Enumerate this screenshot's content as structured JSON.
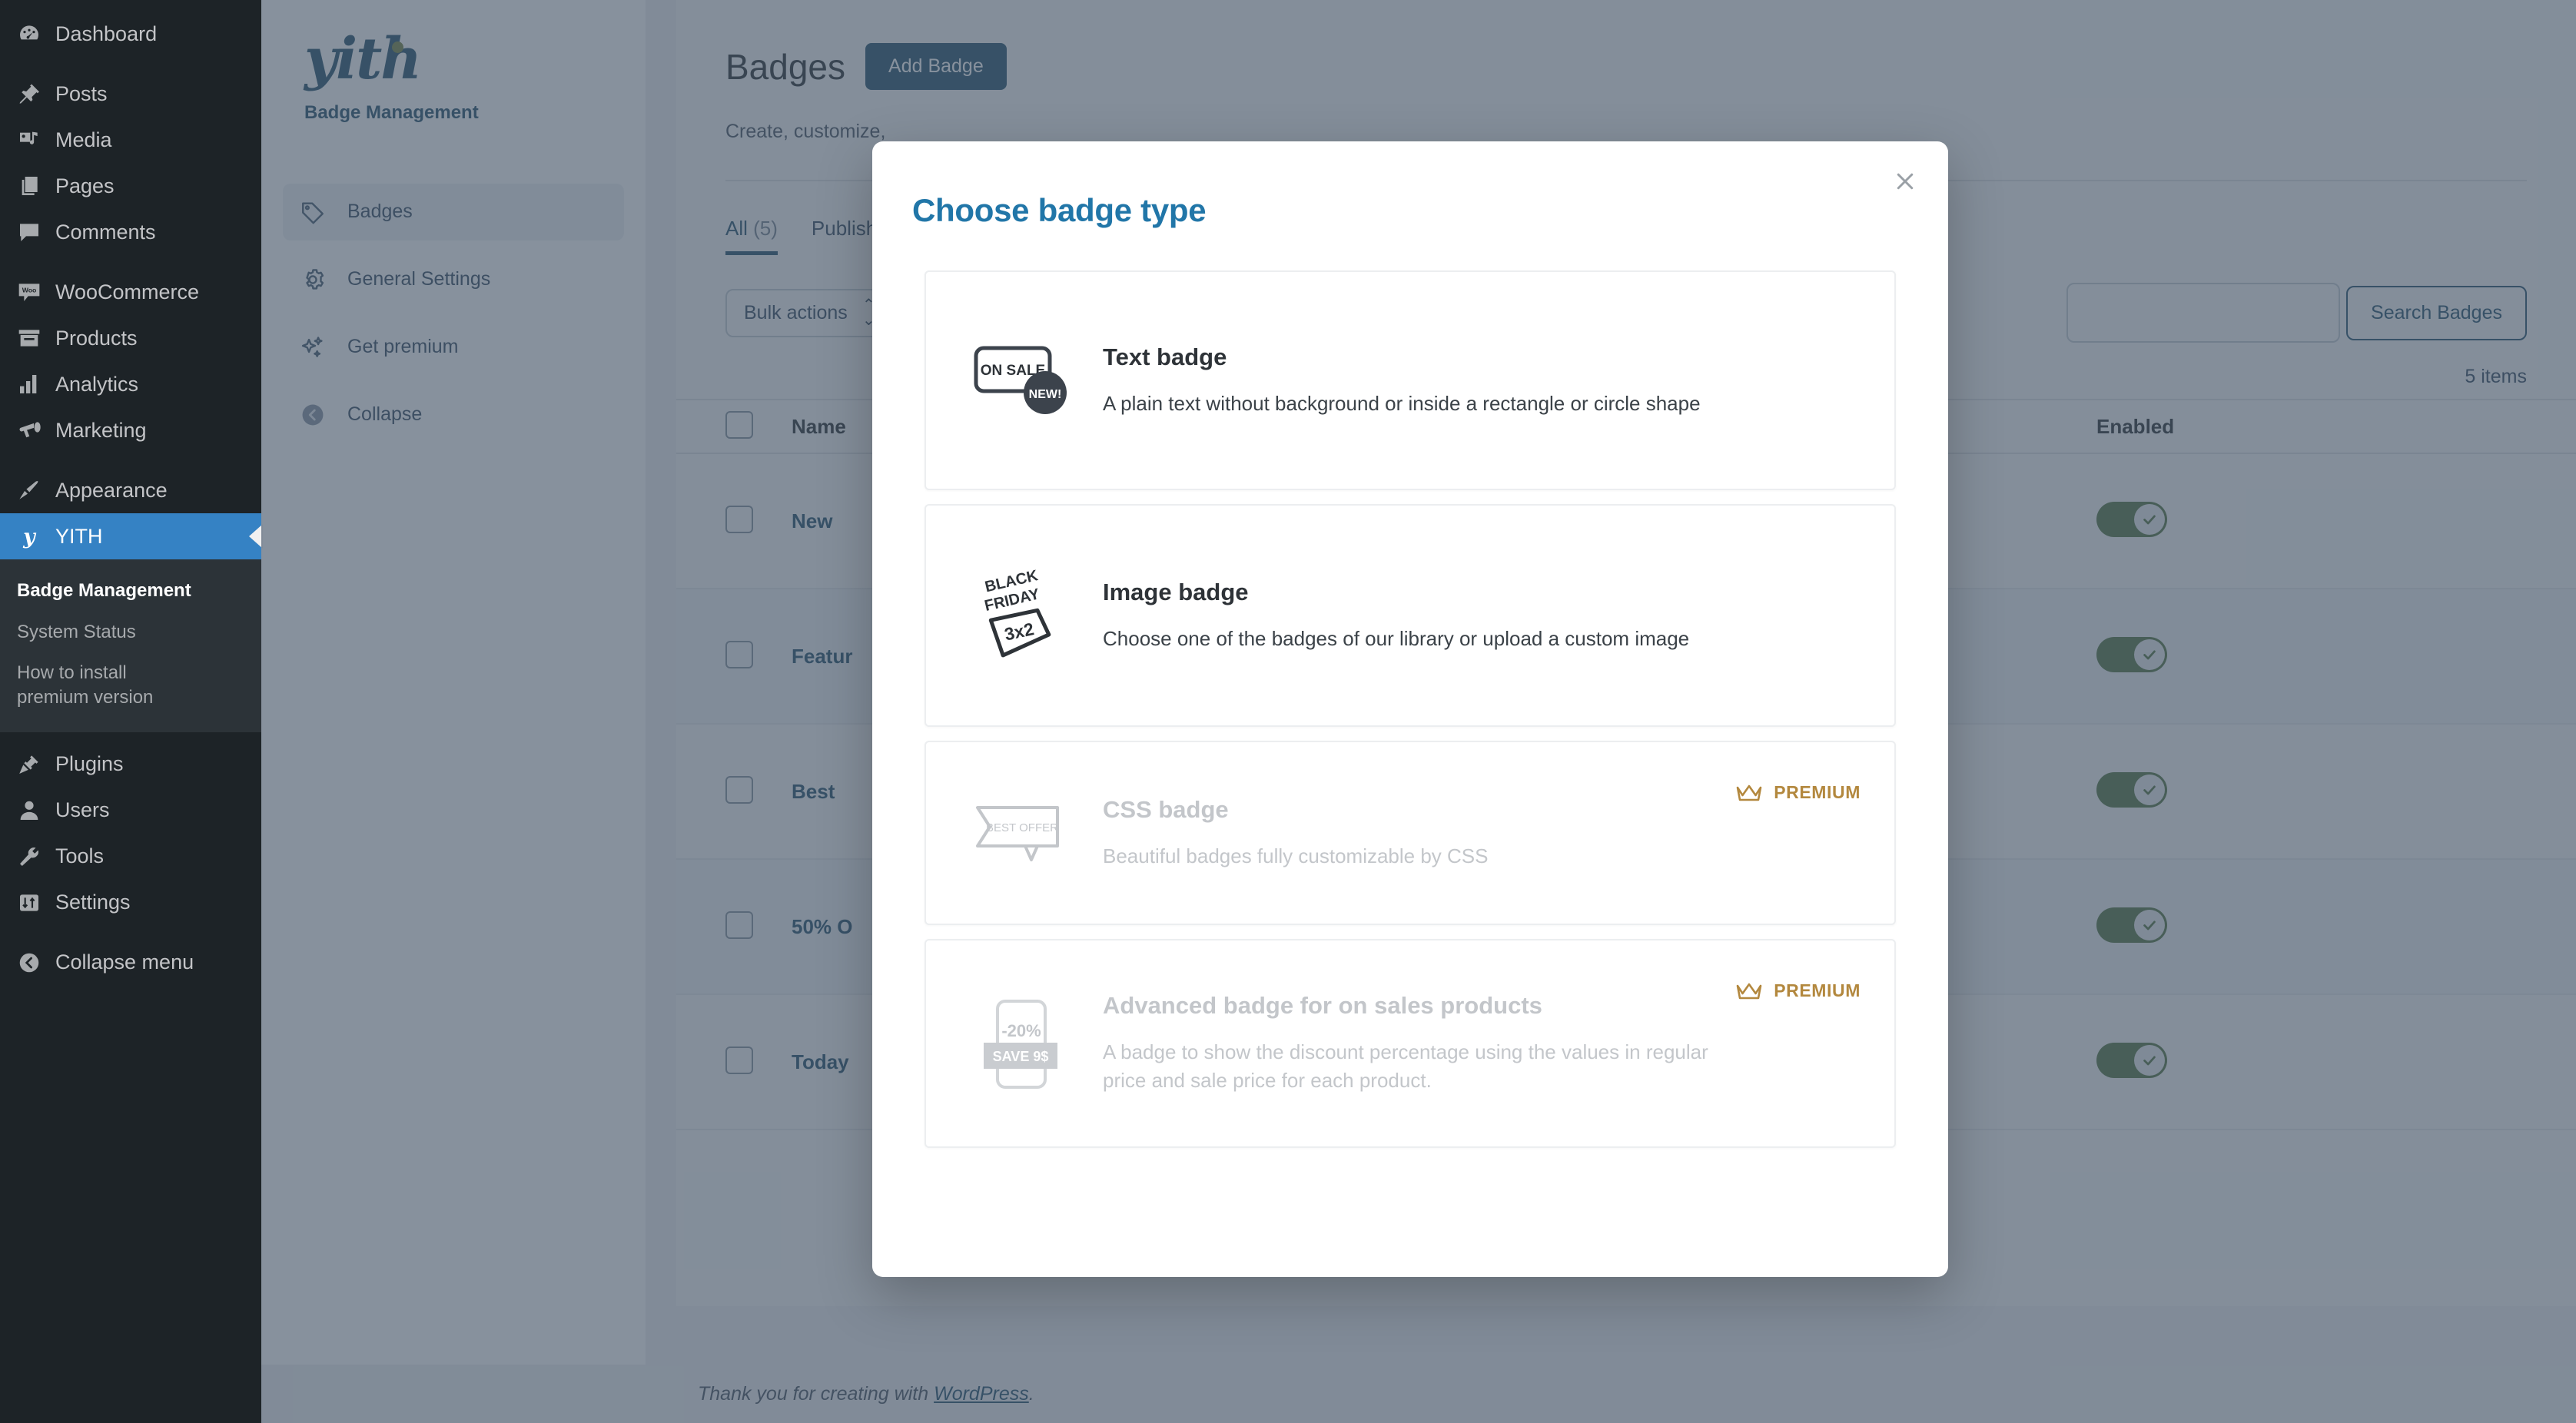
{
  "wp_sidebar": {
    "items": [
      {
        "label": "Dashboard",
        "icon": "dashboard-icon"
      },
      {
        "label": "Posts",
        "icon": "pin-icon"
      },
      {
        "label": "Media",
        "icon": "media-icon"
      },
      {
        "label": "Pages",
        "icon": "pages-icon"
      },
      {
        "label": "Comments",
        "icon": "comment-icon"
      },
      {
        "label": "WooCommerce",
        "icon": "woo-icon"
      },
      {
        "label": "Products",
        "icon": "products-icon"
      },
      {
        "label": "Analytics",
        "icon": "analytics-icon"
      },
      {
        "label": "Marketing",
        "icon": "megaphone-icon"
      },
      {
        "label": "Appearance",
        "icon": "brush-icon"
      },
      {
        "label": "YITH",
        "icon": "yith-icon"
      },
      {
        "label": "Plugins",
        "icon": "plug-icon"
      },
      {
        "label": "Users",
        "icon": "user-icon"
      },
      {
        "label": "Tools",
        "icon": "wrench-icon"
      },
      {
        "label": "Settings",
        "icon": "settings-icon"
      },
      {
        "label": "Collapse menu",
        "icon": "collapse-icon"
      }
    ],
    "yith_submenu": [
      {
        "label": "Badge Management"
      },
      {
        "label": "System Status"
      },
      {
        "label": "How to install premium version"
      }
    ],
    "active_item": "YITH",
    "active_submenu": "Badge Management",
    "accent_color": "#3582c4"
  },
  "plugin_sidebar": {
    "logo_text": "yith",
    "subtitle": "Badge Management",
    "nav": [
      {
        "label": "Badges",
        "icon": "tag-icon",
        "selected": true
      },
      {
        "label": "General Settings",
        "icon": "gear-icon",
        "selected": false
      },
      {
        "label": "Get premium",
        "icon": "sparkle-icon",
        "selected": false
      },
      {
        "label": "Collapse",
        "icon": "collapse-arrow-icon",
        "selected": false
      }
    ]
  },
  "page": {
    "title": "Badges",
    "add_badge_label": "Add Badge",
    "description": "Create, customize,",
    "tabs": [
      {
        "label": "All",
        "count": "(5)",
        "active": true
      },
      {
        "label": "Publish",
        "count": "",
        "active": false
      }
    ],
    "bulk_actions_label": "Bulk actions",
    "search_placeholder": "",
    "search_value": "",
    "search_button_label": "Search Badges",
    "items_count_label": "5 items",
    "table": {
      "columns": [
        "Name",
        "Enabled"
      ],
      "rows": [
        {
          "name": "New",
          "enabled": true
        },
        {
          "name": "Featur",
          "enabled": true
        },
        {
          "name": "Best",
          "enabled": true
        },
        {
          "name": "50% O",
          "enabled": true
        },
        {
          "name": "Today",
          "enabled": true
        }
      ]
    },
    "footer_prefix": "Thank you for creating with ",
    "footer_link": "WordPress",
    "footer_suffix": "."
  },
  "modal": {
    "title": "Choose badge type",
    "close_label": "×",
    "premium_label": "PREMIUM",
    "premium_color": "#b3883e",
    "options": [
      {
        "title": "Text badge",
        "description": "A plain text without background or inside a rectangle or circle shape",
        "icon": "text-badge-preview-icon",
        "icon_text_primary": "ON SALE",
        "icon_text_secondary": "NEW!",
        "premium": false
      },
      {
        "title": "Image badge",
        "description": "Choose one of the badges of our library or upload a custom image",
        "icon": "image-badge-preview-icon",
        "icon_text_primary": "BLACK FRIDAY",
        "icon_text_secondary": "3x2",
        "premium": false
      },
      {
        "title": "CSS badge",
        "description": "Beautiful badges fully customizable by CSS",
        "icon": "css-badge-preview-icon",
        "icon_text_primary": "BEST OFFER",
        "icon_text_secondary": "",
        "premium": true
      },
      {
        "title": "Advanced badge for on sales products",
        "description": "A badge to show the discount percentage using the values in regular price and sale price for each product.",
        "icon": "advanced-badge-preview-icon",
        "icon_text_primary": "-20%",
        "icon_text_secondary": "SAVE 9$",
        "premium": true
      }
    ]
  }
}
